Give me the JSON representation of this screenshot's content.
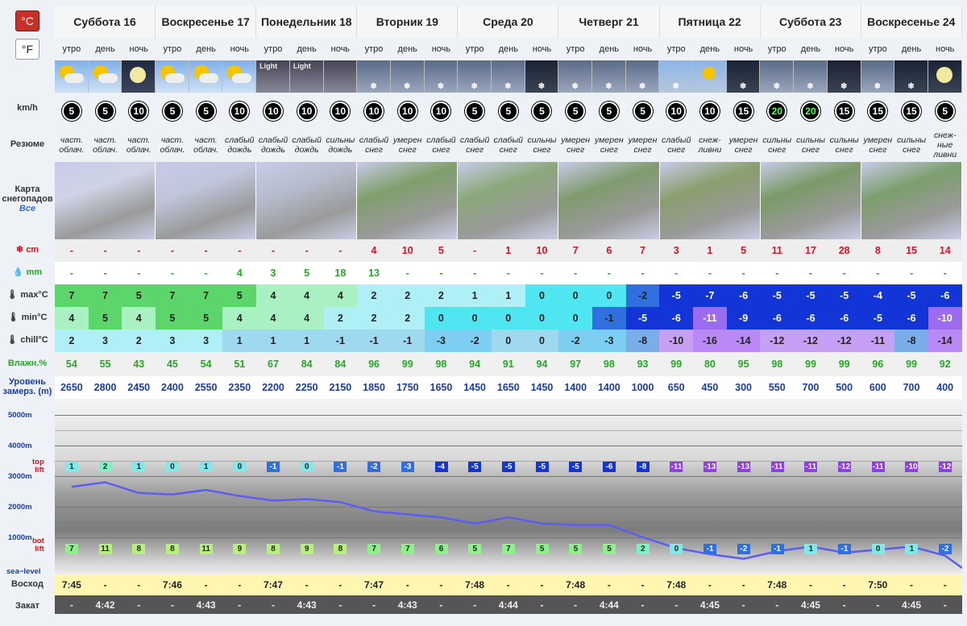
{
  "units": {
    "celsius": "°C",
    "fahrenheit": "°F"
  },
  "labels": {
    "wind": "km/h",
    "summary": "Резюме",
    "map1": "Карта",
    "map2": "снегопадов",
    "map_all": "Все",
    "snow": "cm",
    "rain": "mm",
    "max": "max°C",
    "min": "min°C",
    "chill": "chill°C",
    "humidity": "Влажн.%",
    "freeze1": "Уровень",
    "freeze2": "замерз. (m)",
    "sunrise": "Восход",
    "sunset": "Закат",
    "top1": "top",
    "top2": "lift",
    "bot1": "bot",
    "bot2": "lift",
    "sea": "sea−level"
  },
  "altitude_labels": [
    "5000m",
    "4000m",
    "3000m",
    "2000m",
    "1000m"
  ],
  "days": [
    "Суббота 16",
    "Воскресенье 17",
    "Понедельник 18",
    "Вторник 19",
    "Среда 20",
    "Четверг 21",
    "Пятница 22",
    "Суббота 23",
    "Воскресенье 24"
  ],
  "tod": [
    "утро",
    "день",
    "ночь"
  ],
  "wind": [
    5,
    5,
    10,
    5,
    5,
    10,
    10,
    10,
    10,
    10,
    10,
    10,
    5,
    5,
    5,
    5,
    5,
    5,
    10,
    10,
    15,
    20,
    20,
    15,
    15,
    15,
    5
  ],
  "wind_strong": [
    false,
    false,
    false,
    false,
    false,
    false,
    false,
    false,
    false,
    false,
    false,
    false,
    false,
    false,
    false,
    false,
    false,
    false,
    false,
    false,
    false,
    true,
    true,
    false,
    false,
    false,
    false
  ],
  "summary": [
    "част. облач.",
    "част. облач.",
    "част. облач.",
    "част. облач.",
    "част. облач.",
    "слабый дождь",
    "слабый дождь",
    "слабый дождь",
    "сильны дождь",
    "слабый снег",
    "умерен снег",
    "слабый снег",
    "слабый снег",
    "слабый снег",
    "сильны снег",
    "умерен снег",
    "умерен снег",
    "умерен снег",
    "слабый снег",
    "снеж- ливни",
    "умерен снег",
    "сильны снег",
    "сильны снег",
    "сильны снег",
    "умерен снег",
    "сильны снег",
    "снеж- ные ливни"
  ],
  "icon_text": [
    "",
    "",
    "",
    "",
    "",
    "",
    "Light",
    "Light",
    "",
    "",
    "",
    "",
    "",
    "",
    "",
    "",
    "",
    "",
    "",
    "",
    "",
    "",
    "",
    "",
    "",
    "",
    ""
  ],
  "snow": [
    "-",
    "-",
    "-",
    "-",
    "-",
    "-",
    "-",
    "-",
    "-",
    "4",
    "10",
    "5",
    "-",
    "1",
    "10",
    "7",
    "6",
    "7",
    "3",
    "1",
    "5",
    "11",
    "17",
    "28",
    "8",
    "15",
    "14"
  ],
  "rain": [
    "-",
    "-",
    "-",
    "-",
    "-",
    "4",
    "3",
    "5",
    "18",
    "13",
    "-",
    "-",
    "-",
    "-",
    "-",
    "-",
    "-",
    "-",
    "-",
    "-",
    "-",
    "-",
    "-",
    "-",
    "-",
    "-",
    "-"
  ],
  "tmax": [
    7,
    7,
    5,
    7,
    7,
    5,
    4,
    4,
    4,
    2,
    2,
    2,
    1,
    1,
    0,
    0,
    0,
    -2,
    -5,
    -7,
    -6,
    -5,
    -5,
    -5,
    -4,
    -5,
    -6
  ],
  "tmin": [
    4,
    5,
    4,
    5,
    5,
    4,
    4,
    4,
    2,
    2,
    2,
    0,
    0,
    0,
    0,
    0,
    -1,
    -5,
    -6,
    -11,
    -9,
    -6,
    -6,
    -6,
    -5,
    -6,
    -10
  ],
  "chill": [
    2,
    3,
    2,
    3,
    3,
    1,
    1,
    1,
    -1,
    -1,
    -1,
    -3,
    -2,
    0,
    0,
    -2,
    -3,
    -8,
    -10,
    -16,
    -14,
    -12,
    -12,
    -12,
    -11,
    -8,
    -14
  ],
  "humidity": [
    54,
    55,
    43,
    45,
    54,
    51,
    67,
    84,
    84,
    96,
    99,
    98,
    94,
    91,
    94,
    97,
    98,
    93,
    99,
    80,
    95,
    98,
    99,
    99,
    96,
    99,
    92
  ],
  "freezing": [
    2650,
    2800,
    2450,
    2400,
    2550,
    2350,
    2200,
    2250,
    2150,
    1850,
    1750,
    1650,
    1450,
    1650,
    1450,
    1400,
    1400,
    1000,
    650,
    450,
    300,
    550,
    700,
    500,
    600,
    700,
    400
  ],
  "top_lift": [
    1,
    2,
    1,
    0,
    1,
    0,
    -1,
    0,
    -1,
    -2,
    -3,
    -4,
    -5,
    -5,
    -5,
    -5,
    -6,
    -8,
    -11,
    -13,
    -13,
    -11,
    -11,
    -12,
    -11,
    -10,
    -12
  ],
  "bot_lift": [
    7,
    11,
    8,
    8,
    11,
    9,
    8,
    9,
    8,
    7,
    7,
    6,
    5,
    7,
    5,
    5,
    5,
    2,
    0,
    -1,
    -2,
    -1,
    1,
    -1,
    0,
    1,
    -2
  ],
  "sunrise": [
    "7:45",
    "-",
    "-",
    "7:46",
    "-",
    "-",
    "7:47",
    "-",
    "-",
    "7:47",
    "-",
    "-",
    "7:48",
    "-",
    "-",
    "7:48",
    "-",
    "-",
    "7:48",
    "-",
    "-",
    "7:48",
    "-",
    "-",
    "7:50",
    "-",
    "-"
  ],
  "sunset": [
    "-",
    "4:42",
    "-",
    "-",
    "4:43",
    "-",
    "-",
    "4:43",
    "-",
    "-",
    "4:43",
    "-",
    "-",
    "4:44",
    "-",
    "-",
    "4:44",
    "-",
    "-",
    "4:45",
    "-",
    "-",
    "4:45",
    "-",
    "-",
    "4:45",
    "-"
  ],
  "colors": {
    "warm": "#5cd66a",
    "mild": "#a9f0c2",
    "cool": "#aef0f5",
    "cold": "#4fe6f2",
    "freezing": "#2f6fe0",
    "deep": "#1335d8",
    "verycold": "#9b6cf0",
    "extreme": "#7d3ef0"
  }
}
